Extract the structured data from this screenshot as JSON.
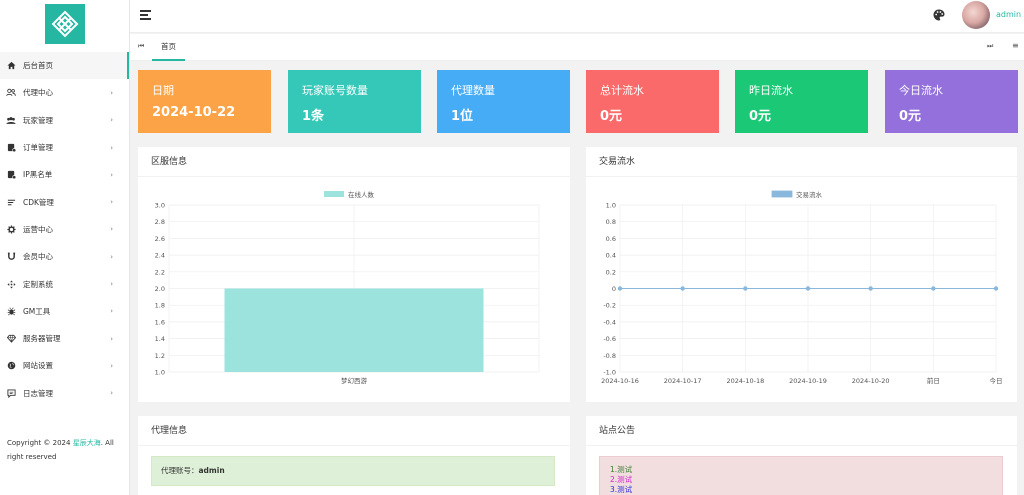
{
  "header": {
    "username": "admin"
  },
  "tabs": {
    "home": "首页"
  },
  "sidebar": {
    "items": [
      {
        "label": "后台首页",
        "icon": "home-icon"
      },
      {
        "label": "代理中心",
        "icon": "users-icon"
      },
      {
        "label": "玩家管理",
        "icon": "group-icon"
      },
      {
        "label": "订单管理",
        "icon": "order-icon"
      },
      {
        "label": "IP黑名单",
        "icon": "blacklist-icon"
      },
      {
        "label": "CDK管理",
        "icon": "list-icon"
      },
      {
        "label": "运营中心",
        "icon": "gear-icon"
      },
      {
        "label": "会员中心",
        "icon": "magnet-icon"
      },
      {
        "label": "定制系统",
        "icon": "move-icon"
      },
      {
        "label": "GM工具",
        "icon": "bug-icon"
      },
      {
        "label": "服务器管理",
        "icon": "diamond-icon"
      },
      {
        "label": "网站设置",
        "icon": "globe-icon"
      },
      {
        "label": "日志管理",
        "icon": "message-icon"
      }
    ]
  },
  "copyright": {
    "prefix": "Copyright © 2024 ",
    "brand": "星辰大海",
    "suffix": ". All right reserved"
  },
  "cards": [
    {
      "title": "日期",
      "value": "2024-10-22",
      "color": "#fba346"
    },
    {
      "title": "玩家账号数量",
      "value": "1条",
      "color": "#35c8b8"
    },
    {
      "title": "代理数量",
      "value": "1位",
      "color": "#46acf5"
    },
    {
      "title": "总计流水",
      "value": "0元",
      "color": "#fb6a6a"
    },
    {
      "title": "昨日流水",
      "value": "0元",
      "color": "#1ac875"
    },
    {
      "title": "今日流水",
      "value": "0元",
      "color": "#9370db"
    }
  ],
  "panels": {
    "server_info": "区服信息",
    "transactions": "交易流水",
    "agent_info": "代理信息",
    "notice": "站点公告"
  },
  "agent": {
    "label": "代理账号：",
    "value": "admin"
  },
  "notice_items": [
    {
      "text": "1.测试",
      "color": "#3a7d2c"
    },
    {
      "text": "2.测试",
      "color": "#d020d0"
    },
    {
      "text": "3.测试",
      "color": "#2a2ae0"
    }
  ],
  "chart_data": [
    {
      "type": "bar",
      "legend": [
        "在线人数"
      ],
      "categories": [
        "梦幻西游"
      ],
      "series": [
        {
          "name": "在线人数",
          "values": [
            2
          ]
        }
      ],
      "ylim": [
        1.0,
        3.0
      ],
      "yticks": [
        "3.0",
        "2.8",
        "2.6",
        "2.4",
        "2.2",
        "2.0",
        "1.8",
        "1.6",
        "1.4",
        "1.2",
        "1.0"
      ],
      "color": "#9be3dc",
      "grid": true,
      "legend_position": "top"
    },
    {
      "type": "line",
      "legend": [
        "交易流水"
      ],
      "categories": [
        "2024-10-16",
        "2024-10-17",
        "2024-10-18",
        "2024-10-19",
        "2024-10-20",
        "前日",
        "今日"
      ],
      "series": [
        {
          "name": "交易流水",
          "values": [
            0,
            0,
            0,
            0,
            0,
            0,
            0
          ]
        }
      ],
      "ylim": [
        -1.0,
        1.0
      ],
      "yticks": [
        "1.0",
        "0.8",
        "0.6",
        "0.4",
        "0.2",
        "0",
        "-0.2",
        "-0.4",
        "-0.6",
        "-0.8",
        "-1.0"
      ],
      "color": "#8ab8dd",
      "grid": true,
      "legend_position": "top"
    }
  ]
}
